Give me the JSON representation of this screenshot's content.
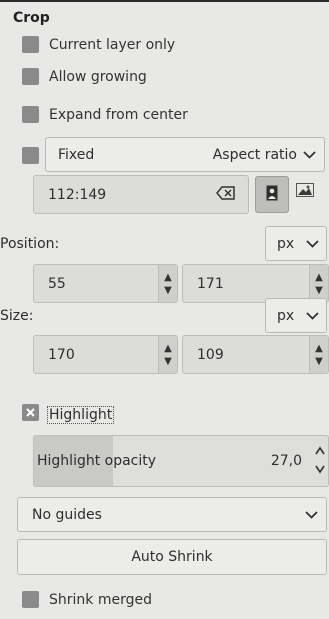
{
  "panel": {
    "title": "Crop",
    "current_layer_only": "Current layer only",
    "allow_growing": "Allow growing",
    "expand_from_center": "Expand from center",
    "fixed_label": "Fixed",
    "fixed_select_value": "Aspect ratio",
    "ratio_value": "112:149",
    "position_label": "Position:",
    "position_unit": "px",
    "position_x": "55",
    "position_y": "171",
    "size_label": "Size:",
    "size_unit": "px",
    "size_w": "170",
    "size_h": "109",
    "highlight_label": "Highlight",
    "highlight_opacity_label": "Highlight opacity",
    "highlight_opacity_value": "27,0",
    "highlight_opacity_fraction": 0.27,
    "guides_value": "No guides",
    "auto_shrink_label": "Auto Shrink",
    "shrink_merged": "Shrink merged"
  },
  "icons": [
    "clear-icon",
    "portrait-icon",
    "landscape-icon",
    "chevron-down-icon",
    "spin-up-icon",
    "spin-down-icon",
    "x-checkbox-icon"
  ],
  "colors": {
    "background": "#e8e8e7",
    "checkbox": "#8a8a8a",
    "field": "#dcdcdb",
    "fill": "#c9c9c8"
  }
}
